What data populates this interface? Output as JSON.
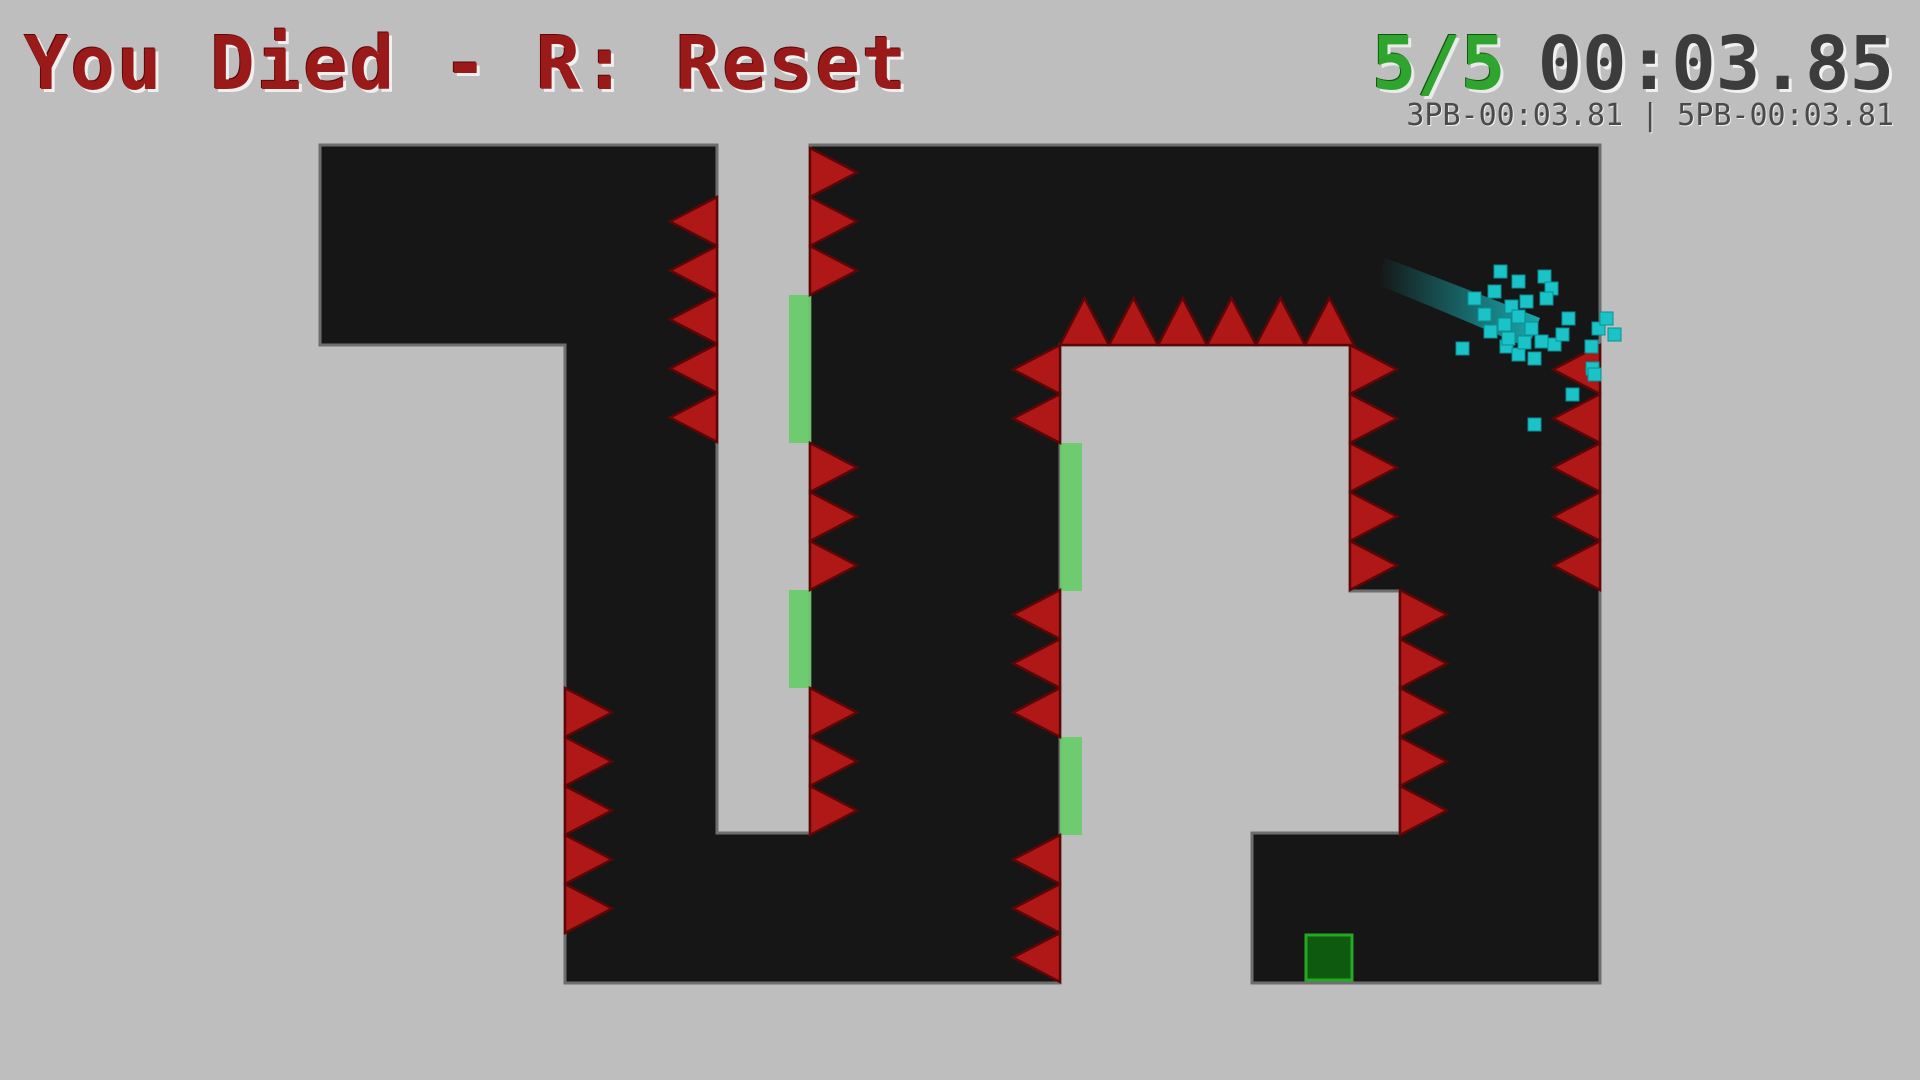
{
  "hud": {
    "status_text": "You Died - R: Reset",
    "counter_text": "5/5",
    "timer_text": "00:03.85",
    "pb_text": "3PB-00:03.81 | 5PB-00:03.81"
  },
  "colors": {
    "background": "#bebebe",
    "wall_fill": "#161616",
    "wall_border": "#6e6e6e",
    "spike_fill": "#b01818",
    "spike_stroke": "#5e0606",
    "jump_pad": "#66cc66",
    "goal_fill": "#0e5a0e",
    "goal_border": "#22aa22",
    "player_particles": "#19c3c8"
  },
  "icons": {
    "spike": "red-triangle-spike-icon",
    "goal": "green-square-goal-icon",
    "player": "cyan-particle-burst-icon"
  }
}
